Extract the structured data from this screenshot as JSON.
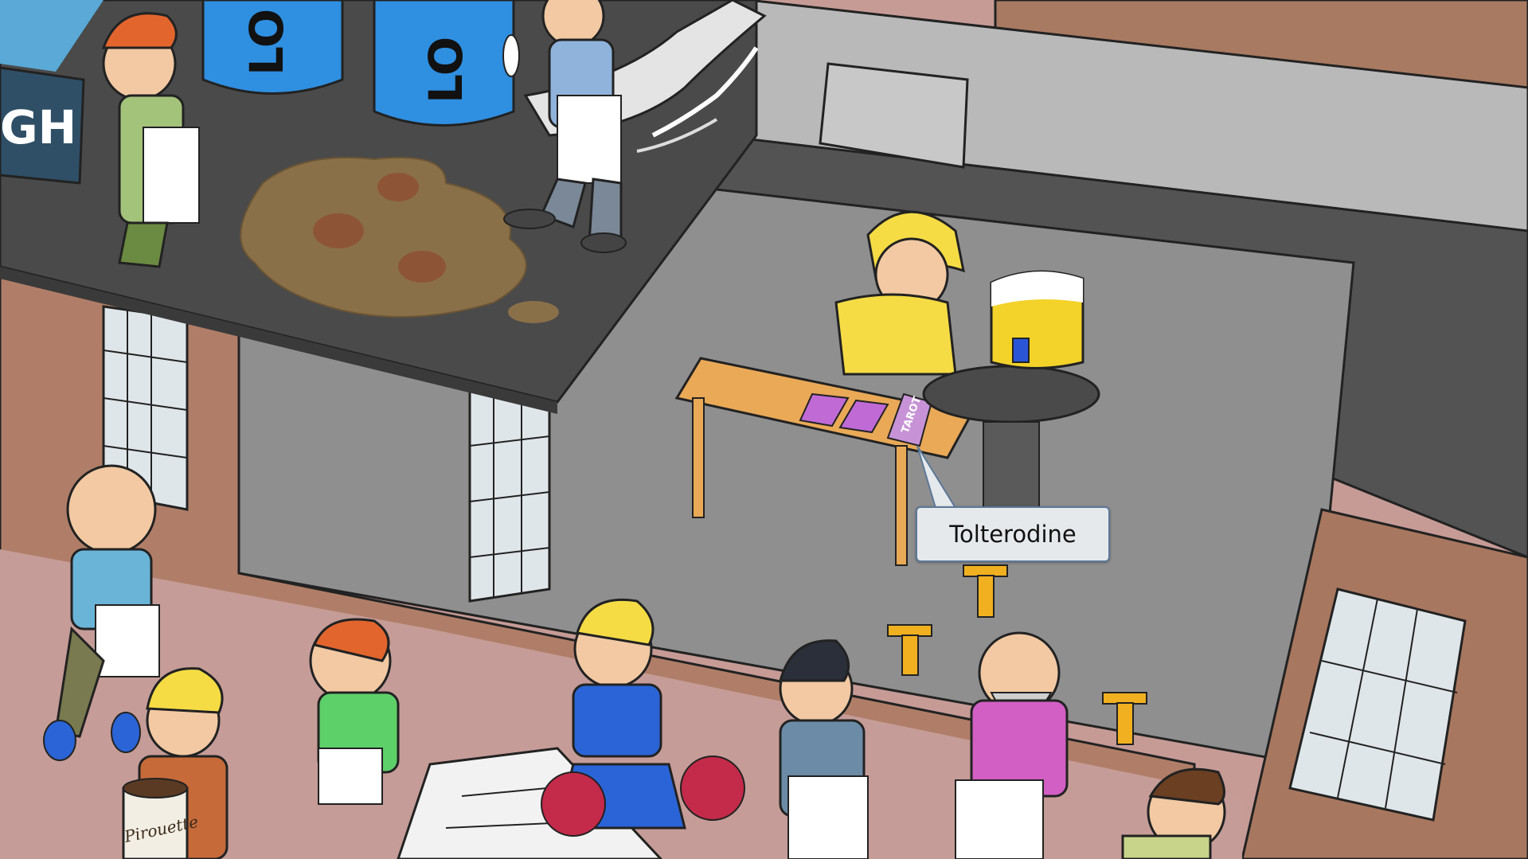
{
  "scene": {
    "sign_text": "GH",
    "tank_left_text": "LO",
    "tank_right_text": "LO",
    "tarot_box_text": "TAROT",
    "can_brand_text": "Pirouette"
  },
  "tooltip": {
    "label": "Tolterodine"
  },
  "colors": {
    "sky": "#5aa9d6",
    "building_wall": "#b08068",
    "pavement": "#c49a94",
    "awning": "#4d4d4d",
    "inner_wall": "#8e8e8e",
    "tank_blue": "#2f8fe0",
    "tooltip_border": "#5c7898"
  }
}
